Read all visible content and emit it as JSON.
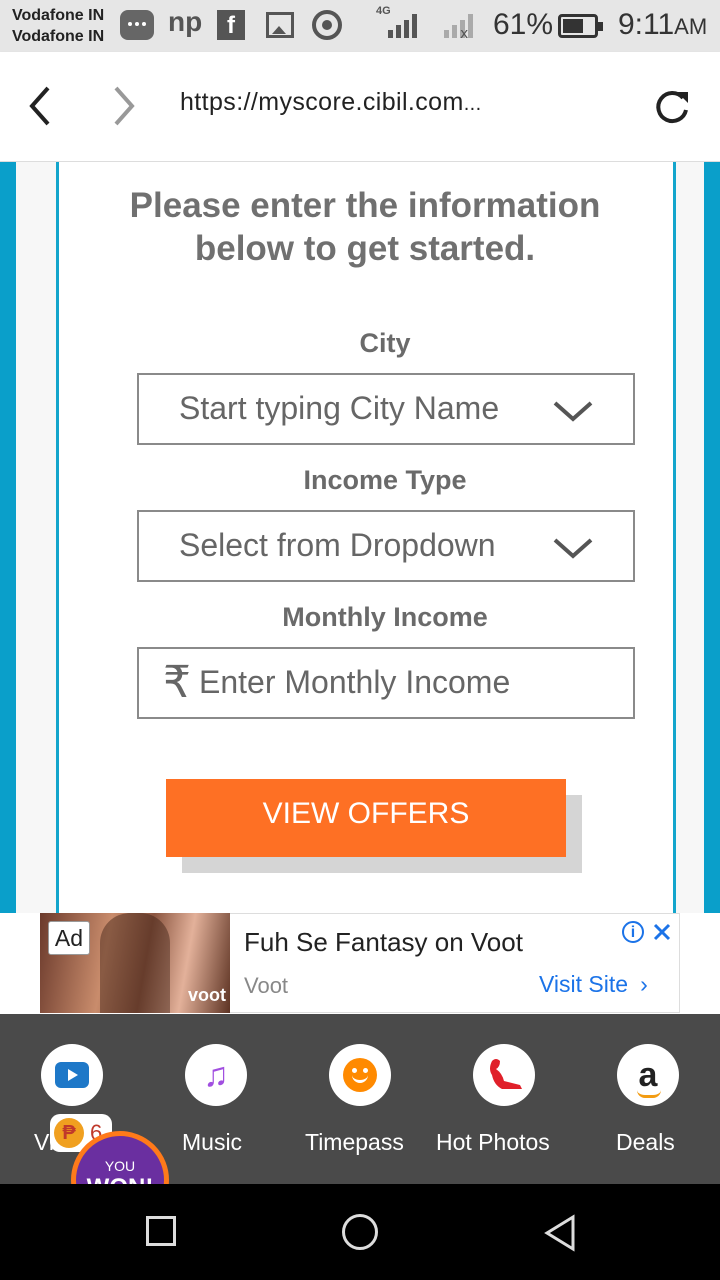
{
  "status_bar": {
    "carrier_1": "Vodafone IN",
    "carrier_2": "Vodafone IN",
    "network": "4G",
    "battery": "61%",
    "time": "9:11",
    "time_suffix": "AM"
  },
  "browser": {
    "url": "https://myscore.cibil.com",
    "url_overflow": "..."
  },
  "form": {
    "intro_line_1": "Please enter the information",
    "intro_line_2": "below to get started.",
    "city_label": "City",
    "city_placeholder": "Start typing City Name",
    "income_type_label": "Income Type",
    "income_type_placeholder": "Select from Dropdown",
    "monthly_income_label": "Monthly Income",
    "currency_symbol": "₹",
    "monthly_income_placeholder": "Enter Monthly Income",
    "submit_label": "VIEW OFFERS"
  },
  "ad": {
    "badge": "Ad",
    "thumbnail_brand": "voot",
    "title": "Fuh Se Fantasy on Voot",
    "source": "Voot",
    "cta": "Visit Site"
  },
  "app_tray": {
    "items": [
      {
        "label": "Vi",
        "icon": "video-play-icon"
      },
      {
        "label": "Music",
        "icon": "music-note-icon"
      },
      {
        "label": "Timepass",
        "icon": "smiley-icon"
      },
      {
        "label": "Hot  Photos",
        "icon": "pinup-silhouette-icon"
      },
      {
        "label": "Deals",
        "icon": "amazon-icon"
      }
    ],
    "coin_count": "6",
    "won_line_1": "YOU",
    "won_line_2": "WON!"
  },
  "colors": {
    "accent_teal": "#0a9fca",
    "button_orange": "#fe7024",
    "link_blue": "#1b73e8",
    "tray_bg": "#4a4a4a",
    "won_purple": "#6a2fa0"
  }
}
